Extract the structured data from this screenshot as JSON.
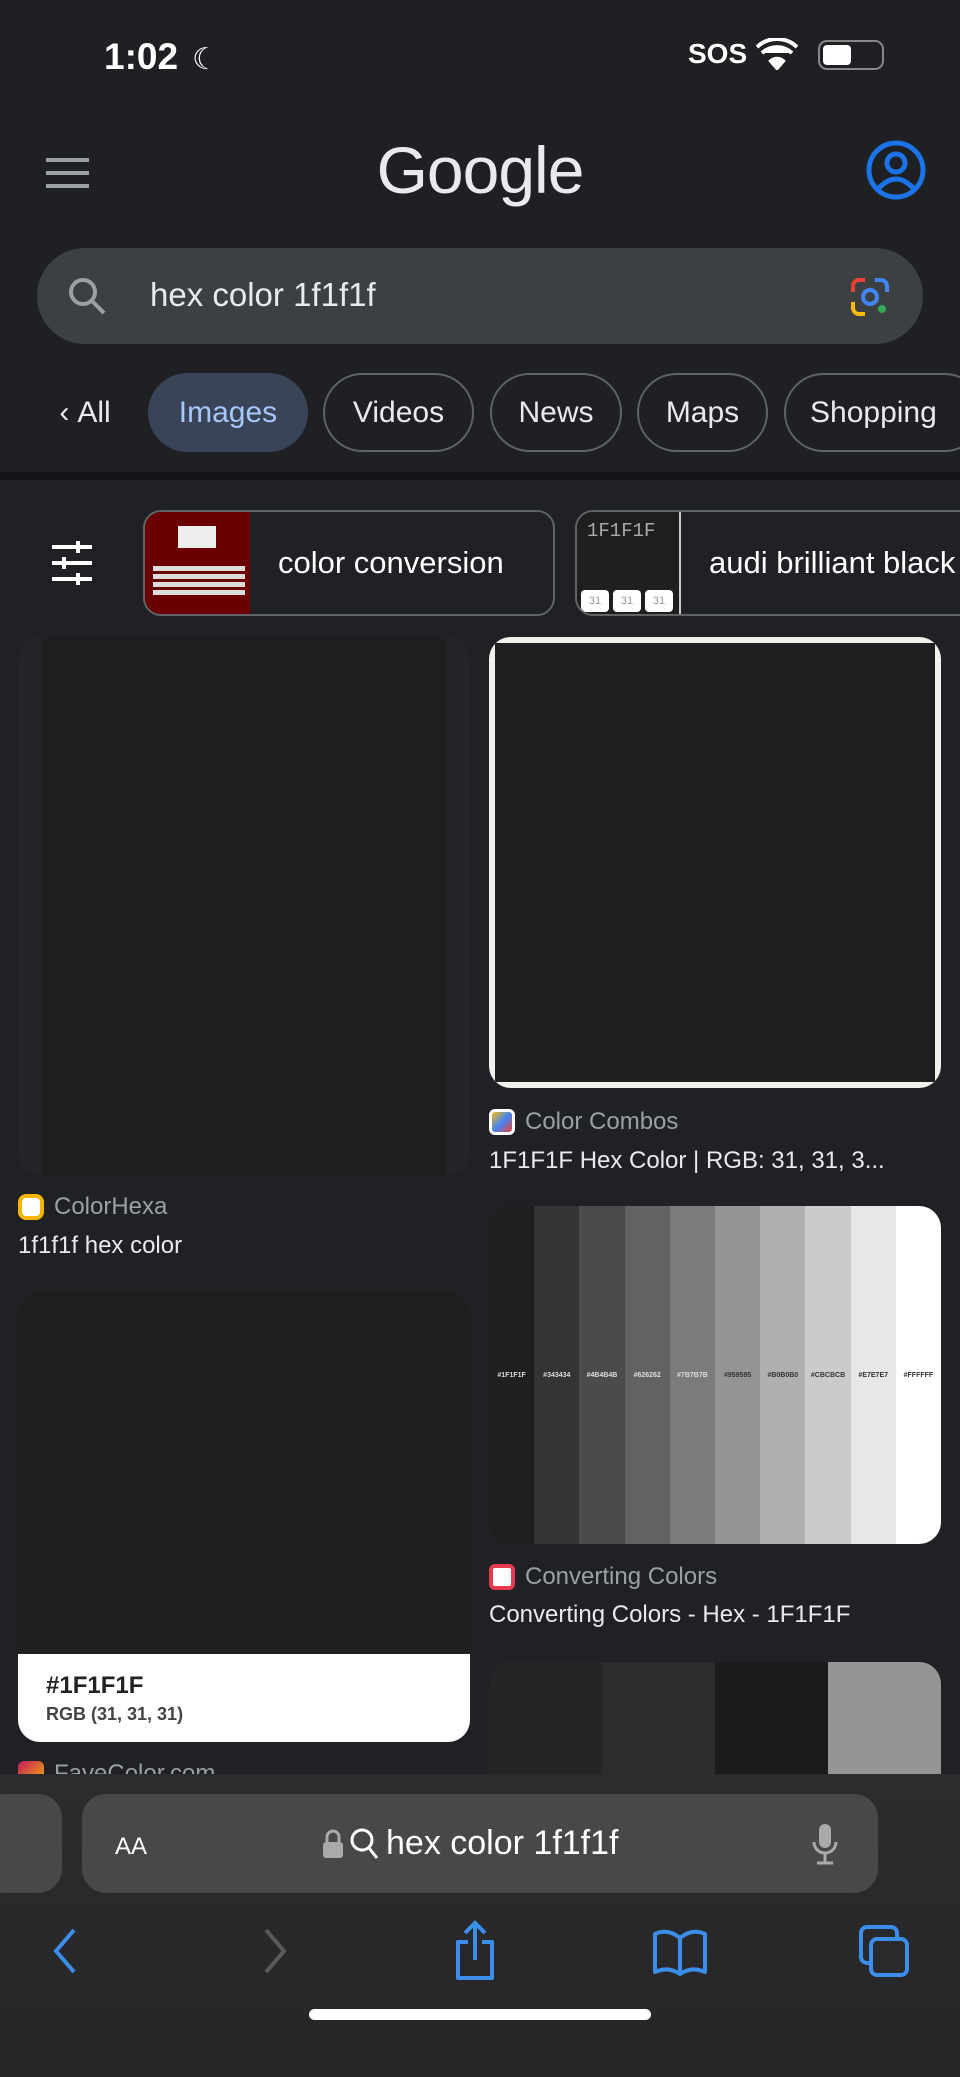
{
  "status_bar": {
    "time": "1:02",
    "sos": "SOS"
  },
  "header": {
    "logo": "Google",
    "menu_icon": "hamburger-icon",
    "account_icon": "account-circle-icon"
  },
  "search": {
    "value": "hex color 1f1f1f",
    "lens_icon": "google-lens-icon"
  },
  "tabs": [
    {
      "label": "All"
    },
    {
      "label": "Images",
      "active": true
    },
    {
      "label": "Videos"
    },
    {
      "label": "News"
    },
    {
      "label": "Maps"
    },
    {
      "label": "Shopping"
    }
  ],
  "chips": [
    {
      "label": "color conversion"
    },
    {
      "label": "audi brilliant black",
      "thumb_text": "1F1F1F",
      "thumb_values": [
        "31",
        "31",
        "31"
      ]
    }
  ],
  "results": [
    {
      "source": "ColorHexa",
      "title": "1f1f1f hex color"
    },
    {
      "source": "Color Combos",
      "title": "1F1F1F Hex Color | RGB: 31, 31, 3..."
    },
    {
      "source": "Converting Colors",
      "title": "Converting Colors - Hex - 1F1F1F",
      "swatches": [
        "#1F1F1F",
        "#343434",
        "#4B4B4B",
        "#626262",
        "#7B7B7B",
        "#959595",
        "#B0B0B0",
        "#CBCBCB",
        "#E7E7E7",
        "#FFFFFF"
      ]
    },
    {
      "source": "FaveColor.com",
      "image_hex": "#1F1F1F",
      "image_rgb": "RGB (31, 31, 31)"
    }
  ],
  "browser": {
    "aa": "AA",
    "url_text": "hex color 1f1f1f"
  },
  "colors": {
    "accent": "#3b8eea",
    "active_tab_bg": "#394457",
    "active_tab_text": "#a8c7fa"
  }
}
